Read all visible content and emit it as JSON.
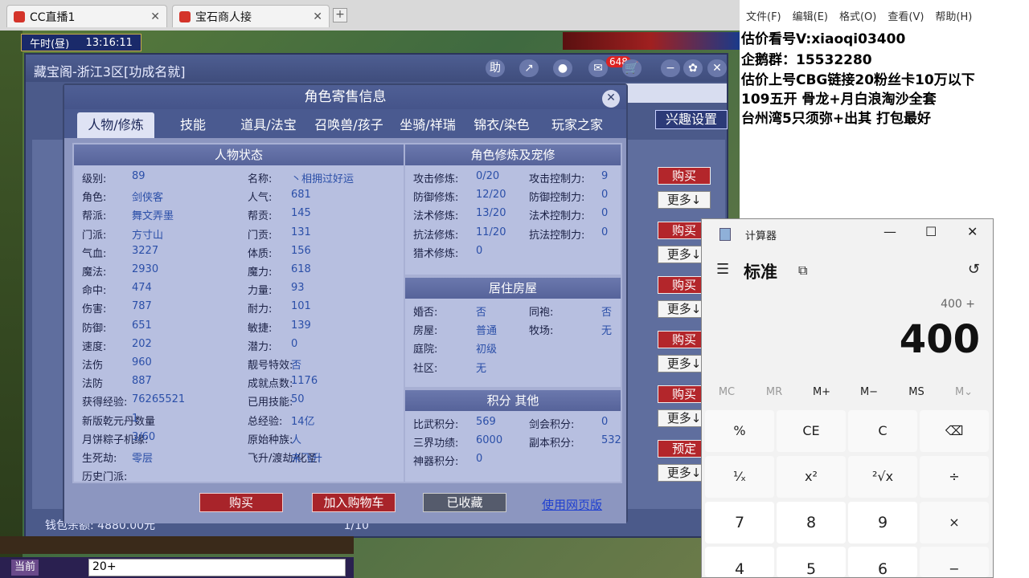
{
  "browser": {
    "tabs": [
      {
        "label": "CC直播1"
      },
      {
        "label": "宝石商人接"
      }
    ],
    "new_tab": "+"
  },
  "game": {
    "time_label": "午时(昼)",
    "clock": "13:16:11",
    "chat_button": "当前",
    "chat_input": "20+"
  },
  "cbg": {
    "title": "藏宝阁-浙江3区[功成名就]",
    "help": "助",
    "cart_count": "648",
    "interest_button": "兴趣设置",
    "wallet": "钱包余额: 4880.00元",
    "page": "1/10",
    "buy_label": "购买",
    "more_label": "更多↓",
    "reserve_label": "预定"
  },
  "dialog": {
    "title": "角色寄售信息",
    "tabs": [
      "人物/修炼",
      "技能",
      "道具/法宝",
      "召唤兽/孩子",
      "坐骑/祥瑞",
      "锦衣/染色",
      "玩家之家"
    ],
    "status_header": "人物状态",
    "left_col": [
      {
        "k": "级别:",
        "v": "89"
      },
      {
        "k": "角色:",
        "v": "剑侠客"
      },
      {
        "k": "帮派:",
        "v": "舞文弄墨"
      },
      {
        "k": "门派:",
        "v": "方寸山"
      },
      {
        "k": "气血:",
        "v": "3227"
      },
      {
        "k": "魔法:",
        "v": "2930"
      },
      {
        "k": "命中:",
        "v": "474"
      },
      {
        "k": "伤害:",
        "v": "787"
      },
      {
        "k": "防御:",
        "v": "651"
      },
      {
        "k": "速度:",
        "v": "202"
      },
      {
        "k": "法伤",
        "v": "960"
      },
      {
        "k": "法防",
        "v": "887"
      },
      {
        "k": "获得经验:",
        "v": "76265521"
      },
      {
        "k": "新版乾元丹数量",
        "v": "1"
      },
      {
        "k": "月饼粽子机缘:",
        "v": "3/60"
      },
      {
        "k": "生死劫:",
        "v": "零层"
      },
      {
        "k": "历史门派:",
        "v": ""
      }
    ],
    "mid_col": [
      {
        "k": "名称:",
        "v": "丶相拥过好运"
      },
      {
        "k": "人气:",
        "v": "681"
      },
      {
        "k": "帮贡:",
        "v": "145"
      },
      {
        "k": "门贡:",
        "v": "131"
      },
      {
        "k": "体质:",
        "v": "156"
      },
      {
        "k": "魔力:",
        "v": "618"
      },
      {
        "k": "力量:",
        "v": "93"
      },
      {
        "k": "耐力:",
        "v": "101"
      },
      {
        "k": "敏捷:",
        "v": "139"
      },
      {
        "k": "潜力:",
        "v": "0"
      },
      {
        "k": "靓号特效:",
        "v": "否"
      },
      {
        "k": "成就点数:",
        "v": "1176"
      },
      {
        "k": "已用技能:",
        "v": "50"
      },
      {
        "k": "总经验:",
        "v": "14亿"
      },
      {
        "k": "原始种族:",
        "v": "人"
      },
      {
        "k": "飞升/渡劫/化圣:",
        "v": "未飞升"
      }
    ],
    "cultivation_header": "角色修炼及宠修",
    "cultivation": [
      {
        "k": "攻击修炼:",
        "v": "0/20",
        "k2": "攻击控制力:",
        "v2": "9"
      },
      {
        "k": "防御修炼:",
        "v": "12/20",
        "k2": "防御控制力:",
        "v2": "0"
      },
      {
        "k": "法术修炼:",
        "v": "13/20",
        "k2": "法术控制力:",
        "v2": "0"
      },
      {
        "k": "抗法修炼:",
        "v": "11/20",
        "k2": "抗法控制力:",
        "v2": "0"
      },
      {
        "k": "猎术修炼:",
        "v": "0",
        "k2": "",
        "v2": ""
      }
    ],
    "house_header": "居住房屋",
    "house": [
      {
        "k": "婚否:",
        "v": "否",
        "k2": "同袍:",
        "v2": "否"
      },
      {
        "k": "房屋:",
        "v": "普通",
        "k2": "牧场:",
        "v2": "无"
      },
      {
        "k": "庭院:",
        "v": "初级",
        "k2": "",
        "v2": ""
      },
      {
        "k": "社区:",
        "v": "无",
        "k2": "",
        "v2": ""
      }
    ],
    "points_header": "积分 其他",
    "points": [
      {
        "k": "比武积分:",
        "v": "569",
        "k2": "剑会积分:",
        "v2": "0"
      },
      {
        "k": "三界功绩:",
        "v": "6000",
        "k2": "副本积分:",
        "v2": "532"
      },
      {
        "k": "神器积分:",
        "v": "0",
        "k2": "",
        "v2": ""
      }
    ],
    "buttons": {
      "buy": "购买",
      "add_cart": "加入购物车",
      "favorited": "已收藏",
      "web": "使用网页版"
    }
  },
  "notepad": {
    "menu": [
      "文件(F)",
      "编辑(E)",
      "格式(O)",
      "查看(V)",
      "帮助(H)"
    ],
    "lines": [
      "估价看号V:xiaoqi03400",
      "企鹅群：15532280",
      "估价上号CBG链接20粉丝卡10万以下",
      "109五开 骨龙+月白浪淘沙全套",
      "台州湾5只须弥+出其 打包最好"
    ]
  },
  "calculator": {
    "title": "计算器",
    "mode": "标准",
    "expression": "400 +",
    "display": "400",
    "memory": [
      "MC",
      "MR",
      "M+",
      "M−",
      "MS",
      "M⌄"
    ],
    "keys_row1": [
      "%",
      "CE",
      "C",
      "⌫"
    ],
    "keys_row2": [
      "¹⁄ₓ",
      "x²",
      "²√x",
      "÷"
    ],
    "keys_row3": [
      "7",
      "8",
      "9",
      "×"
    ],
    "keys_row4": [
      "4",
      "5",
      "6",
      "−"
    ]
  }
}
